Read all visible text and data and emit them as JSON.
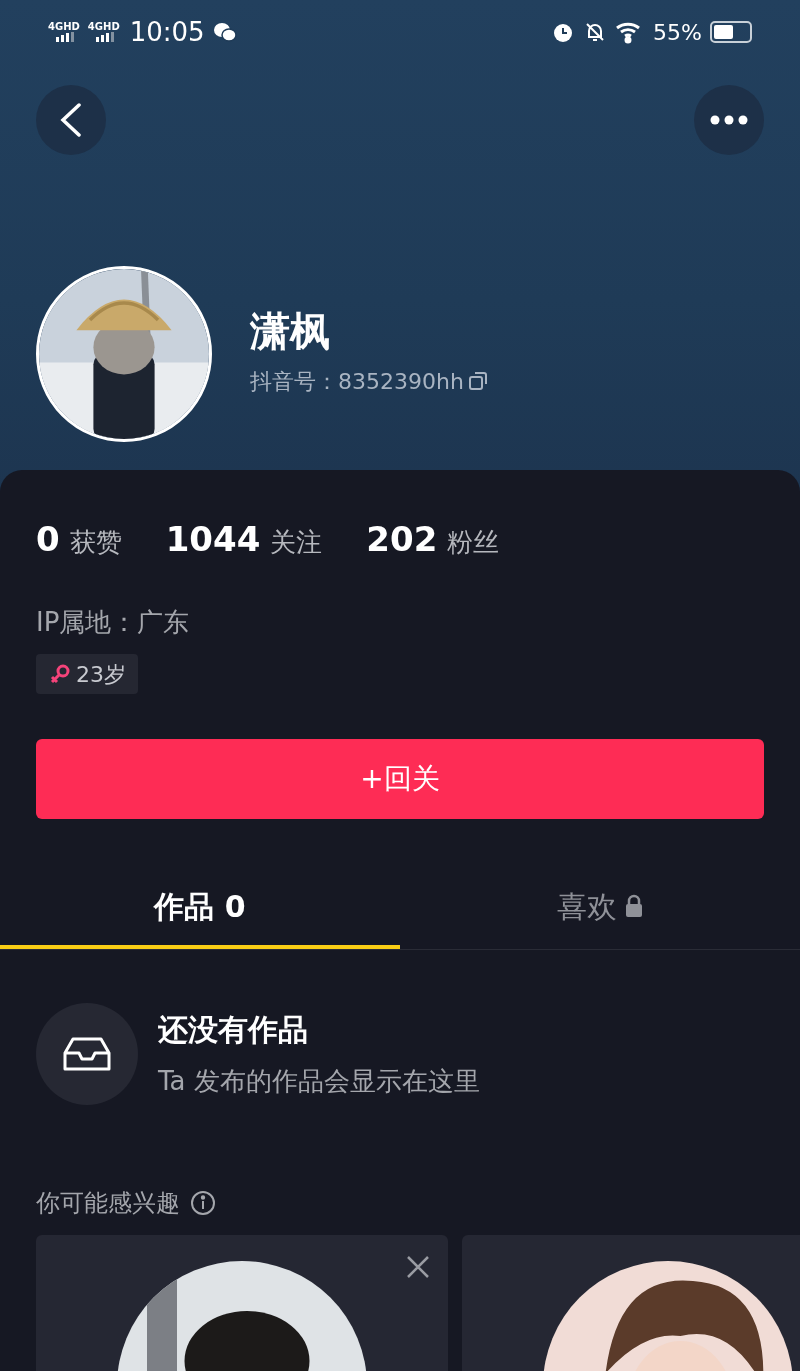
{
  "status_bar": {
    "networks": [
      "4GHD",
      "4GHD"
    ],
    "time": "10:05",
    "battery": "55%"
  },
  "profile": {
    "name": "潇枫",
    "id_text": "抖音号：8352390hh"
  },
  "stats": [
    {
      "number": "0",
      "unit": "获赞"
    },
    {
      "number": "1044",
      "unit": "关注"
    },
    {
      "number": "202",
      "unit": "粉丝"
    }
  ],
  "ip": "IP属地：广东",
  "age": "23岁",
  "follow_button": "+回关",
  "tabs": [
    {
      "label": "作品 0",
      "selected": true,
      "locked": false
    },
    {
      "label": "喜欢",
      "selected": false,
      "locked": true
    }
  ],
  "empty": {
    "title": "还没有作品",
    "subtitle": "Ta 发布的作品会显示在这里"
  },
  "suggestions": {
    "title": "你可能感兴趣",
    "cards": [
      {
        "kind": "picture",
        "dismissible": true
      },
      {
        "kind": "picture"
      }
    ]
  }
}
